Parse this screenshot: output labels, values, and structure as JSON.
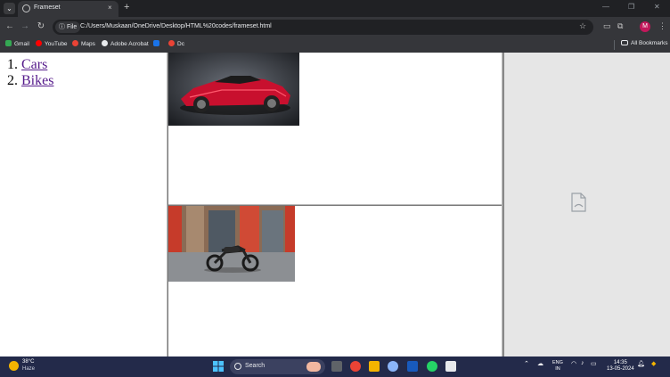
{
  "browser": {
    "tab_title": "Frameset",
    "tab_close": "×",
    "new_tab": "+",
    "url_chip": "File",
    "url": "C:/Users/Muskaan/OneDrive/Desktop/HTML%20codes/frameset.html",
    "avatar_letter": "M",
    "window_controls": [
      "—",
      "❐",
      "✕"
    ]
  },
  "bookmarks": {
    "items": [
      {
        "label": "Gmail",
        "color": "#34a853"
      },
      {
        "label": "YouTube",
        "color": "#ff0000"
      },
      {
        "label": "Maps",
        "color": "#ea4335"
      },
      {
        "label": "Adobe Acrobat",
        "color": "#e8eaed"
      },
      {
        "label": "",
        "color": "#1a73e8"
      },
      {
        "label": "Dc",
        "color": "#ea4335"
      }
    ],
    "all_bookmarks": "All Bookmarks"
  },
  "page": {
    "nav_list": [
      {
        "number": "1.",
        "label": "Cars"
      },
      {
        "number": "2.",
        "label": "Bikes"
      }
    ]
  },
  "taskbar": {
    "weather_temp": "38°C",
    "weather_desc": "Haze",
    "search_label": "Search",
    "lang_line1": "ENG",
    "lang_line2": "IN",
    "time": "14:35",
    "date": "13-05-2024"
  }
}
